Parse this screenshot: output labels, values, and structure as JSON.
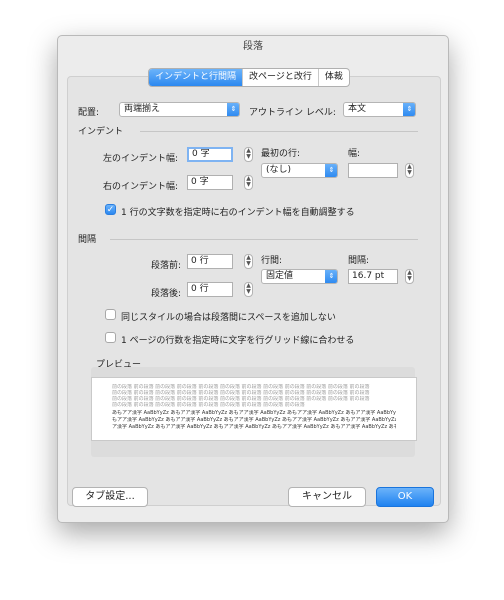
{
  "dialog": {
    "title": "段落"
  },
  "tabs": [
    {
      "label": "インデントと行間隔",
      "active": true
    },
    {
      "label": "改ページと改行",
      "active": false
    },
    {
      "label": "体裁",
      "active": false
    }
  ],
  "alignment": {
    "label": "配置:",
    "value": "両端揃え"
  },
  "outline": {
    "label": "アウトライン レベル:",
    "value": "本文"
  },
  "indent": {
    "section_title": "インデント",
    "left_label": "左のインデント幅:",
    "left_value": "0 字",
    "right_label": "右のインデント幅:",
    "right_value": "0 字",
    "first_line_label": "最初の行:",
    "first_line_value": "(なし)",
    "width_label": "幅:",
    "width_value": "",
    "auto_adjust_label": "1 行の文字数を指定時に右のインデント幅を自動調整する",
    "auto_adjust_checked": true
  },
  "spacing": {
    "section_title": "間隔",
    "before_label": "段落前:",
    "before_value": "0 行",
    "after_label": "段落後:",
    "after_value": "0 行",
    "line_spacing_label": "行間:",
    "line_spacing_value": "固定値",
    "interval_label": "間隔:",
    "interval_value": "16.7 pt",
    "no_space_same_style_label": "同じスタイルの場合は段落間にスペースを追加しない",
    "no_space_same_style_checked": false,
    "snap_to_grid_label": "1 ページの行数を指定時に文字を行グリッド線に合わせる",
    "snap_to_grid_checked": false
  },
  "preview": {
    "title": "プレビュー",
    "lines_before": [
      "前の段落 前の段落 前の段落 前の段落 前の段落 前の段落 前の段落 前の段落 前の段落 前の段落 前の段落 前の段落",
      "前の段落 前の段落 前の段落 前の段落 前の段落 前の段落 前の段落 前の段落 前の段落 前の段落 前の段落 前の段落",
      "前の段落 前の段落 前の段落 前の段落 前の段落 前の段落 前の段落 前の段落 前の段落 前の段落 前の段落 前の段落",
      "前の段落 前の段落 前の段落 前の段落 前の段落 前の段落 前の段落 前の段落 前の段落"
    ],
    "lines_sample": [
      "あもアア漢字 AaBbYyZz あもアア漢字 AaBbYyZz あもアア漢字 AaBbYyZz あもアア漢字 AaBbYyZz あもアア漢字 AaBbYyZz あ",
      "もアア漢字 AaBbYyZz あもアア漢字 AaBbYyZz あもアア漢字 AaBbYyZz あもアア漢字 AaBbYyZz あもアア漢字 AaBbYyZz あもア",
      "ア漢字 AaBbYyZz あもアア漢字 AaBbYyZz あもアア漢字 AaBbYyZz あもアア漢字 AaBbYyZz あもアア漢字 AaBbYyZz あもア"
    ]
  },
  "buttons": {
    "tabs_label": "タブ設定...",
    "cancel_label": "キャンセル",
    "ok_label": "OK"
  },
  "colors": {
    "accent": "#2b88f0",
    "panel": "#e4e4e4",
    "dialog": "#ececec"
  }
}
